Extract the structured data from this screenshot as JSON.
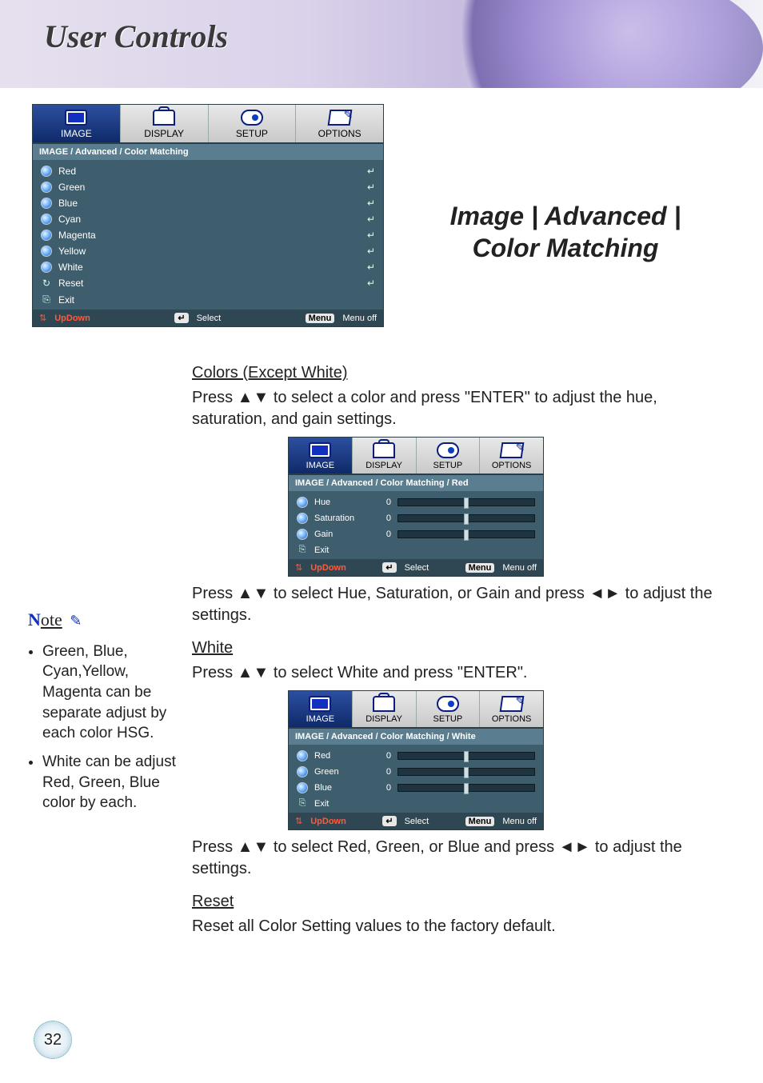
{
  "page_title": "User Controls",
  "right_title_lines": [
    "Image | Advanced |",
    "Color Matching"
  ],
  "page_number": "32",
  "osd_tabs": [
    "IMAGE",
    "DISPLAY",
    "SETUP",
    "OPTIONS"
  ],
  "osd1": {
    "breadcrumb": "IMAGE / Advanced / Color Matching",
    "items": [
      "Red",
      "Green",
      "Blue",
      "Cyan",
      "Magenta",
      "Yellow",
      "White"
    ],
    "reset": "Reset",
    "exit": "Exit"
  },
  "osd_footer": {
    "updown": "UpDown",
    "select_icon": "↵",
    "select": "Select",
    "menu_pill": "Menu",
    "menuoff": "Menu off"
  },
  "heading_colors": "Colors (Except White)",
  "para_colors": "Press ▲▼ to select a color and press \"ENTER\" to adjust the hue, saturation, and gain settings.",
  "osd2": {
    "breadcrumb": "IMAGE / Advanced / Color Matching / Red",
    "sliders": [
      {
        "label": "Hue",
        "value": "0"
      },
      {
        "label": "Saturation",
        "value": "0"
      },
      {
        "label": "Gain",
        "value": "0"
      }
    ],
    "exit": "Exit"
  },
  "para_hsg": "Press ▲▼ to select Hue, Saturation, or Gain and press ◄► to adjust the settings.",
  "heading_white": "White",
  "para_white1": "Press ▲▼ to select White and press \"ENTER\".",
  "osd3": {
    "breadcrumb": "IMAGE / Advanced / Color Matching / White",
    "sliders": [
      {
        "label": "Red",
        "value": "0"
      },
      {
        "label": "Green",
        "value": "0"
      },
      {
        "label": "Blue",
        "value": "0"
      }
    ],
    "exit": "Exit"
  },
  "para_white2": "Press ▲▼ to select Red, Green, or Blue and press ◄► to adjust the settings.",
  "heading_reset": "Reset",
  "para_reset": "Reset all Color Setting values to the factory default.",
  "note": {
    "label_N": "N",
    "label_rest": "ote",
    "items": [
      "Green, Blue, Cyan,Yellow, Magenta can be separate adjust by each color HSG.",
      "White can be adjust Red, Green, Blue color by each."
    ]
  }
}
